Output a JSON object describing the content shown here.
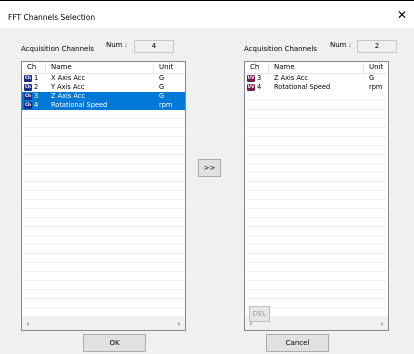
{
  "window": {
    "title": "FFT Channels Selection"
  },
  "icons": {
    "close": "close-icon",
    "badge": "channel-type-badge",
    "scroll_left": "scroll-left-arrow-icon",
    "scroll_right": "scroll-right-arrow-icon"
  },
  "colors": {
    "selection": "#0078d7",
    "badge_acc": "#1c2a8a",
    "badge_speed": "#7a1a4a"
  },
  "left_panel": {
    "section_label": "Acquisition Channels",
    "num_label": "Num :",
    "num_value": "4",
    "columns": [
      "Ch",
      "Name",
      "Unit"
    ],
    "rows": [
      {
        "badge": "Ch",
        "ch": "1",
        "name": "X Axis Acc",
        "unit": "G",
        "selected": false
      },
      {
        "badge": "Ch",
        "ch": "2",
        "name": "Y Axis Acc",
        "unit": "G",
        "selected": false
      },
      {
        "badge": "Ch",
        "ch": "3",
        "name": "Z Axis Acc",
        "unit": "G",
        "selected": true
      },
      {
        "badge": "Ch",
        "ch": "4",
        "name": "Rotational Speed",
        "unit": "rpm",
        "selected": true
      }
    ]
  },
  "right_panel": {
    "section_label": "Acquisition Channels",
    "num_label": "Num :",
    "num_value": "2",
    "columns": [
      "Ch",
      "Name",
      "Unit"
    ],
    "rows": [
      {
        "badge": "UV",
        "ch": "3",
        "name": "Z Axis Acc",
        "unit": "G",
        "selected": false
      },
      {
        "badge": "UV",
        "ch": "4",
        "name": "Rotational Speed",
        "unit": "rpm",
        "selected": false
      }
    ]
  },
  "buttons": {
    "add": ">>",
    "delete": "DEL",
    "ok": "OK",
    "cancel": "Cancel"
  }
}
